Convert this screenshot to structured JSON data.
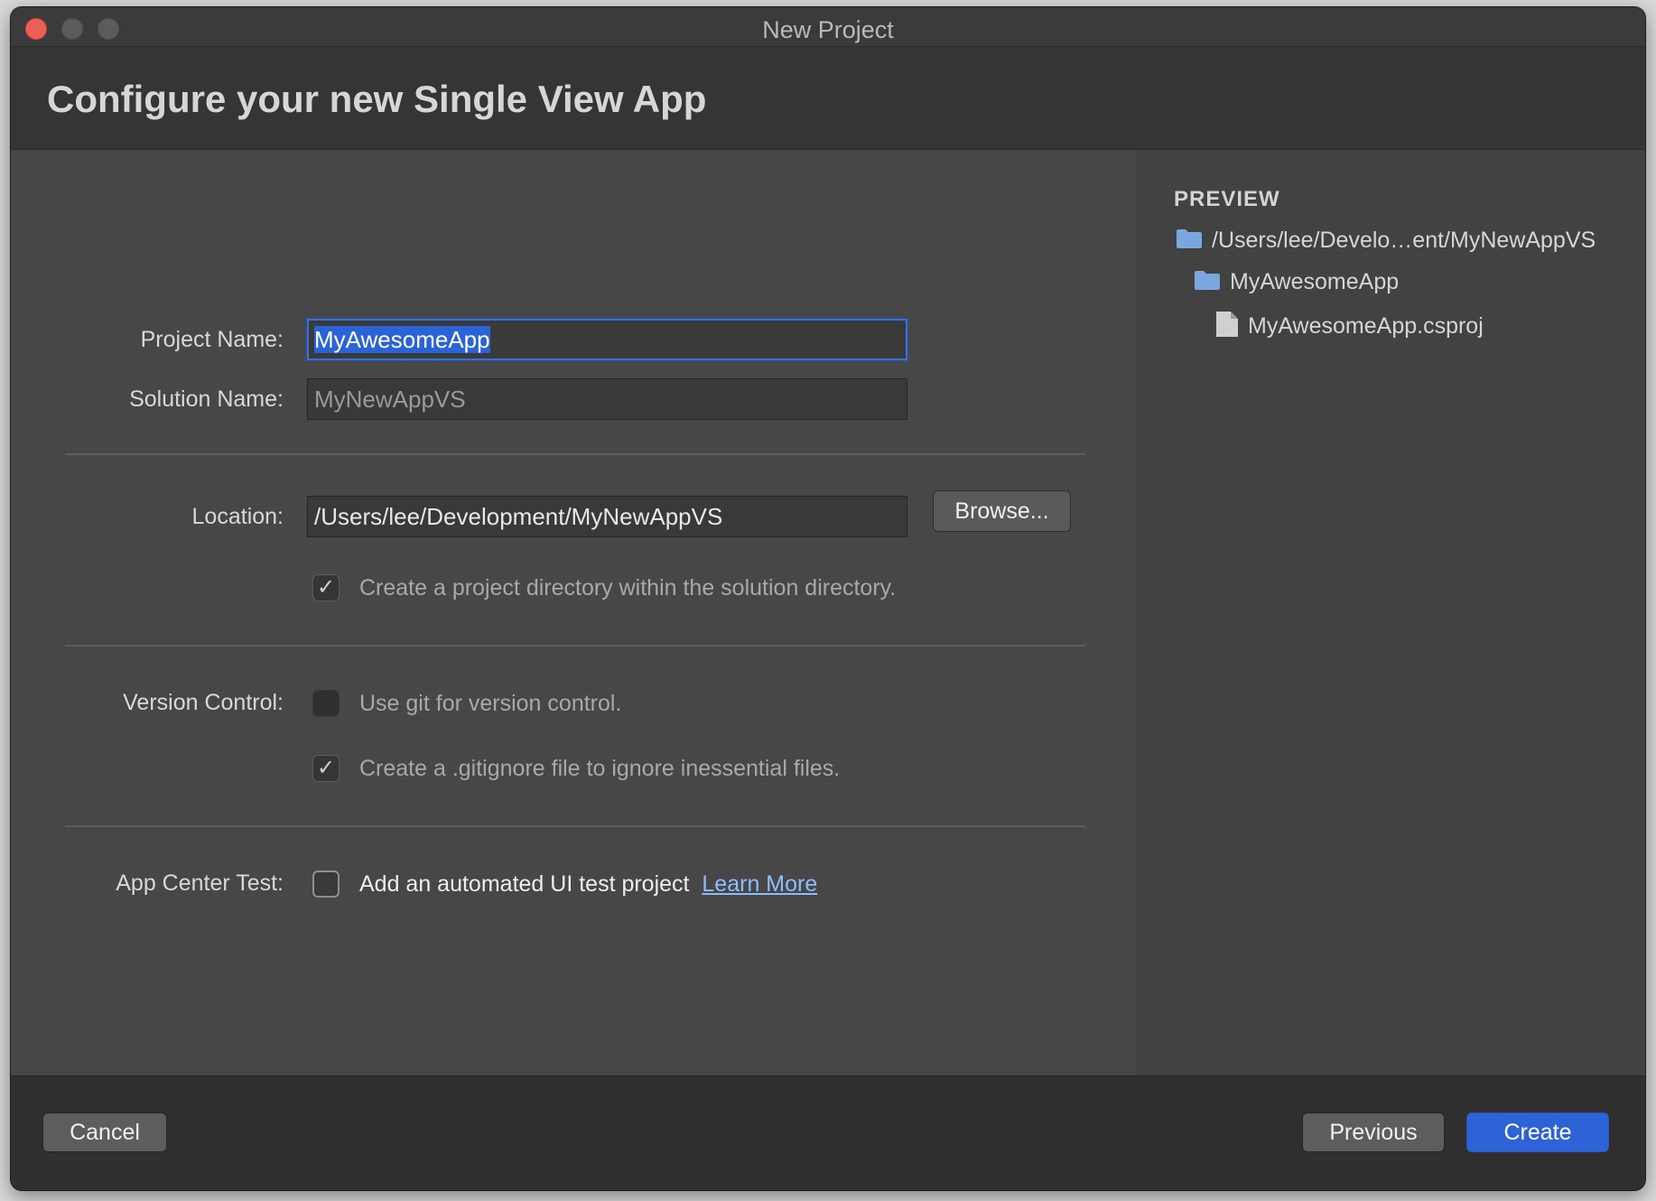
{
  "window": {
    "title": "New Project"
  },
  "header": {
    "title": "Configure your new Single View App"
  },
  "form": {
    "project_name_label": "Project Name:",
    "project_name_value": "MyAwesomeApp",
    "solution_name_label": "Solution Name:",
    "solution_name_value": "MyNewAppVS",
    "location_label": "Location:",
    "location_value": "/Users/lee/Development/MyNewAppVS",
    "browse_label": "Browse...",
    "create_project_dir_label": "Create a project directory within the solution directory.",
    "create_project_dir_checked": true,
    "version_control_label": "Version Control:",
    "use_git_label": "Use git for version control.",
    "use_git_checked": false,
    "gitignore_label": "Create a .gitignore file to ignore inessential files.",
    "gitignore_checked": true,
    "app_center_label": "App Center Test:",
    "ui_test_label": "Add an automated UI test project",
    "ui_test_checked": false,
    "learn_more_label": "Learn More"
  },
  "preview": {
    "title": "PREVIEW",
    "items": [
      {
        "label": "/Users/lee/Develo…ent/MyNewAppVS",
        "icon": "folder-icon"
      },
      {
        "label": "MyAwesomeApp",
        "icon": "folder-icon"
      },
      {
        "label": "MyAwesomeApp.csproj",
        "icon": "file-icon"
      }
    ]
  },
  "footer": {
    "cancel_label": "Cancel",
    "previous_label": "Previous",
    "create_label": "Create"
  },
  "colors": {
    "accent": "#2d63d6",
    "link": "#8fbdfb",
    "close_button": "#ec5f57",
    "folder_icon": "#7aa7e0"
  }
}
